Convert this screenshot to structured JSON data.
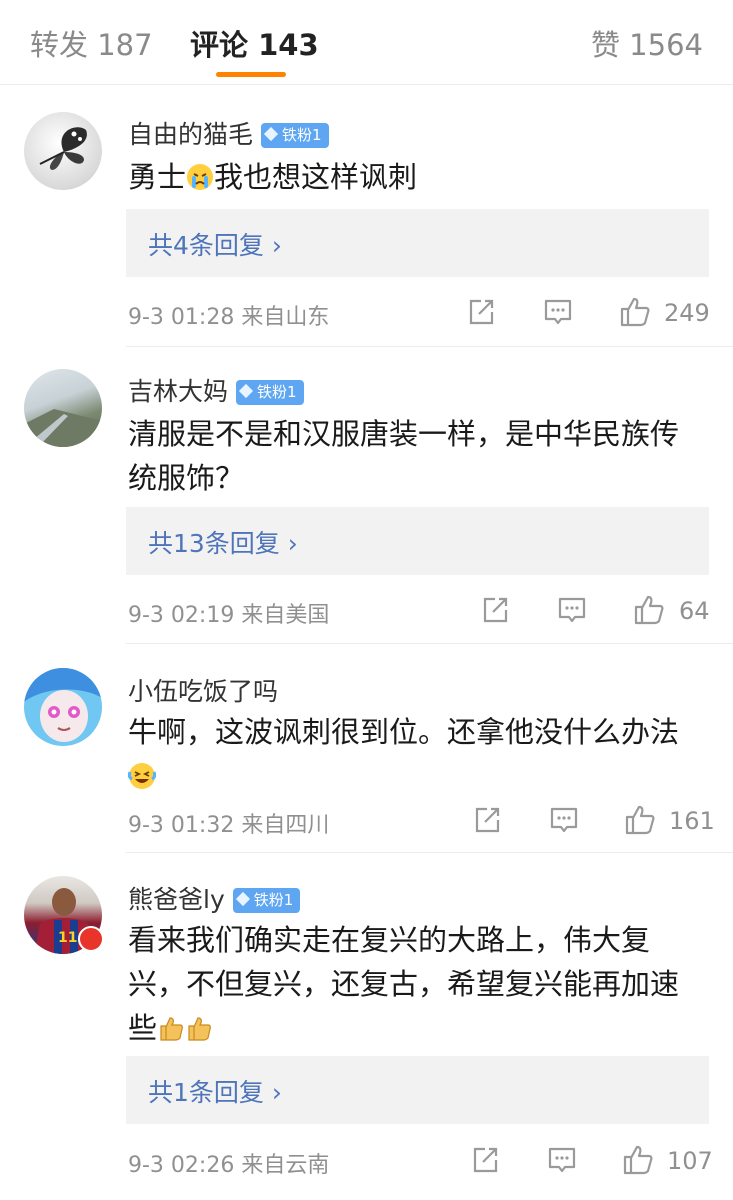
{
  "tabs": {
    "repost": "转发 187",
    "comments": "评论 143",
    "likes": "赞 1564"
  },
  "colors": {
    "accent": "#ff8200",
    "link": "#4e74b9",
    "badge": "#5fa6f2"
  },
  "comments": [
    {
      "name": "自由的猫毛",
      "badge": "铁粉1",
      "text_before": "勇士",
      "emoji1": "crying-face",
      "text_after": "我也想这样讽刺",
      "replies": "共4条回复 ›",
      "meta": "9-3 01:28  来自山东",
      "likes": "249"
    },
    {
      "name": "吉林大妈",
      "badge": "铁粉1",
      "line1": "清服是不是和汉服唐装一样，是中华民族传",
      "line2": "统服饰？",
      "replies": "共13条回复 ›",
      "meta": "9-3 02:19  来自美国",
      "likes": "64"
    },
    {
      "name": "小伍吃饭了吗",
      "line1": "牛啊，这波讽刺很到位。还拿他没什么办法",
      "emoji": "laughing-tears-face",
      "meta": "9-3 01:32  来自四川",
      "likes": "161"
    },
    {
      "name": "熊爸爸ly",
      "badge": "铁粉1",
      "line1": "看来我们确实走在复兴的大路上，伟大复",
      "line2": "兴，不但复兴，还复古，希望复兴能再加速",
      "line3": "些",
      "emoji": "thumbs-up",
      "replies": "共1条回复 ›",
      "meta": "9-3 02:26  来自云南",
      "likes": "107"
    }
  ]
}
